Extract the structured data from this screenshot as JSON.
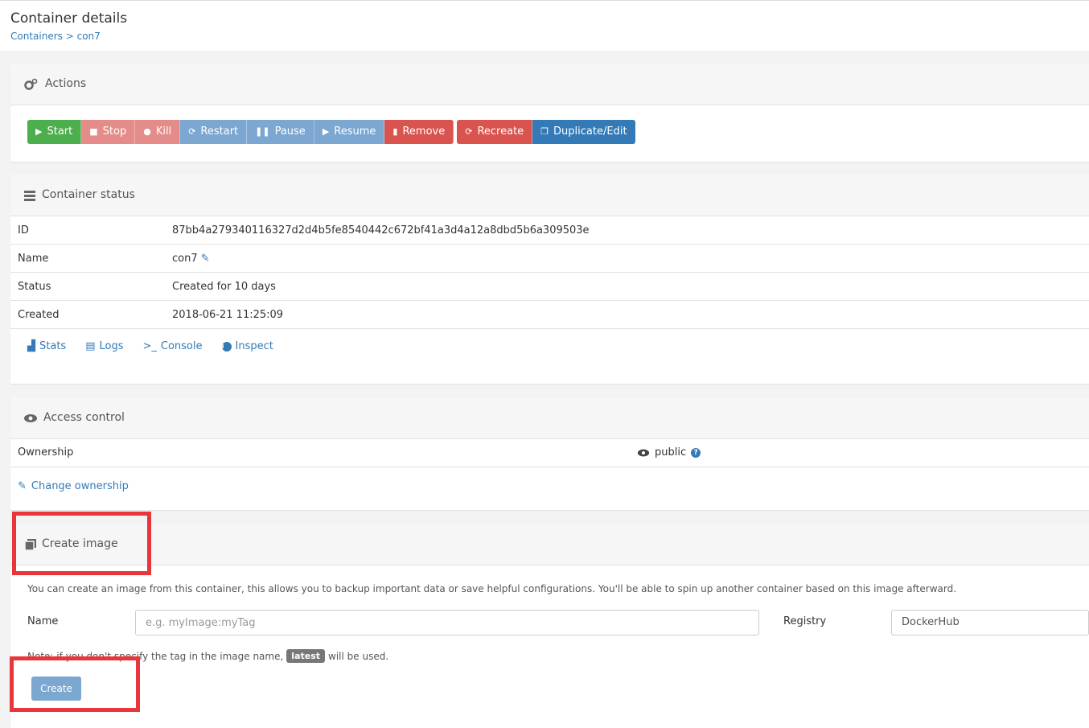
{
  "header": {
    "title": "Container details",
    "breadcrumb_parent": "Containers",
    "breadcrumb_sep": " > ",
    "breadcrumb_current": "con7"
  },
  "actions": {
    "title": "Actions",
    "buttons": [
      "Start",
      "Stop",
      "Kill",
      "Restart",
      "Pause",
      "Resume",
      "Remove",
      "Recreate",
      "Duplicate/Edit"
    ]
  },
  "status": {
    "title": "Container status",
    "rows": [
      {
        "label": "ID",
        "value": "87bb4a279340116327d2d4b5fe8540442c672bf41a3d4a12a8dbd5b6a309503e"
      },
      {
        "label": "Name",
        "value": "con7"
      },
      {
        "label": "Status",
        "value": "Created for 10 days"
      },
      {
        "label": "Created",
        "value": "2018-06-21 11:25:09"
      }
    ],
    "links": [
      "Stats",
      "Logs",
      "Console",
      "Inspect"
    ]
  },
  "access": {
    "title": "Access control",
    "ownership_label": "Ownership",
    "ownership_value": "public",
    "change_label": "Change ownership"
  },
  "create_image": {
    "title": "Create image",
    "description": "You can create an image from this container, this allows you to backup important data or save helpful configurations. You'll be able to spin up another container based on this image afterward.",
    "name_label": "Name",
    "name_placeholder": "e.g. myImage:myTag",
    "registry_label": "Registry",
    "registry_value": "DockerHub",
    "note_before": "Note: if you don't specify the tag in the image name,",
    "note_tag": "latest",
    "note_after": "will be used.",
    "create_label": "Create"
  },
  "colors": {
    "highlight": "#e8363a",
    "link": "#337ab7",
    "success": "#4cae4c",
    "danger": "#d9534f"
  }
}
